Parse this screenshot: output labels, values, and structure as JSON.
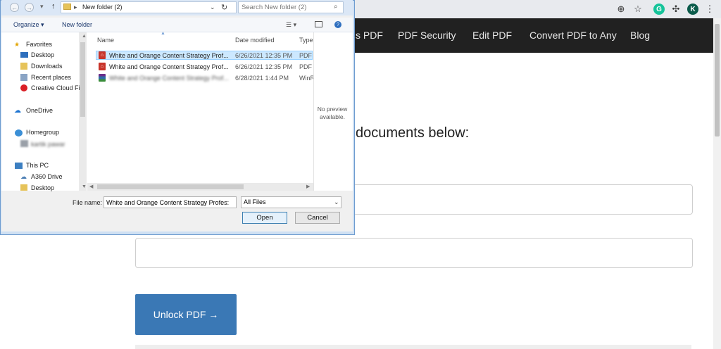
{
  "browser": {
    "avatar_letter": "K",
    "extension_letter": "G",
    "icons": [
      "zoom-icon",
      "star-icon",
      "grammarly-icon",
      "puzzle-icon",
      "avatar",
      "kebab-menu-icon"
    ]
  },
  "site": {
    "nav": [
      "s PDF",
      "PDF Security",
      "Edit PDF",
      "Convert PDF to Any",
      "Blog"
    ],
    "headline": "documents below:",
    "unlock_button": "Unlock PDF →",
    "colors": {
      "nav_bg": "#212121",
      "button_bg": "#3a78b5"
    }
  },
  "dialog": {
    "breadcrumb": "New folder (2)",
    "search_placeholder": "Search New folder (2)",
    "toolbar": {
      "organize": "Organize ▾",
      "new_folder": "New folder"
    },
    "nav_pane": {
      "favorites": "Favorites",
      "favorites_items": [
        "Desktop",
        "Downloads",
        "Recent places",
        "Creative Cloud Fi"
      ],
      "onedrive": "OneDrive",
      "homegroup": "Homegroup",
      "homegroup_user": "kartik pawar",
      "this_pc": "This PC",
      "this_pc_items": [
        "A360 Drive",
        "Desktop"
      ]
    },
    "columns": {
      "name": "Name",
      "date_modified": "Date modified",
      "type": "Type"
    },
    "files": [
      {
        "name": "White and Orange Content Strategy Prof...",
        "date": "6/26/2021 12:35 PM",
        "type": "PDF F"
      },
      {
        "name": "White and Orange Content Strategy Prof...",
        "date": "6/26/2021 12:35 PM",
        "type": "PDF F"
      },
      {
        "name": "White and Orange Content Strategy Prof...",
        "date": "6/28/2021 1:44 PM",
        "type": "WinR"
      }
    ],
    "preview_text": "No preview available.",
    "file_name_label": "File name:",
    "file_name_value": "White and Orange Content Strategy Profes:",
    "file_type": "All Files",
    "open_button": "Open",
    "cancel_button": "Cancel"
  }
}
